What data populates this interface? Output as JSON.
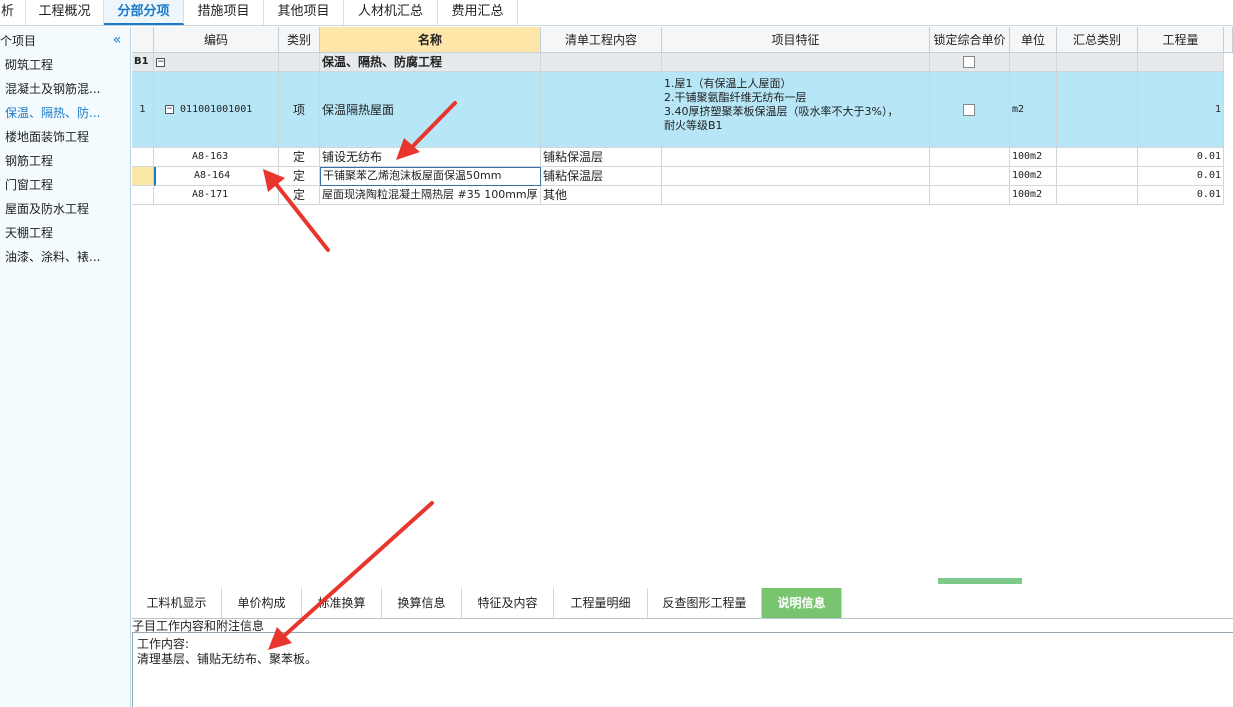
{
  "top_tabs": [
    {
      "label": "析"
    },
    {
      "label": "工程概况"
    },
    {
      "label": "分部分项",
      "active": true
    },
    {
      "label": "措施项目"
    },
    {
      "label": "其他项目"
    },
    {
      "label": "人材机汇总"
    },
    {
      "label": "费用汇总"
    }
  ],
  "sidebar": {
    "title": "个项目",
    "items": [
      {
        "label": "砌筑工程"
      },
      {
        "label": "混凝土及钢筋混..."
      },
      {
        "label": "保温、隔热、防...",
        "active": true
      },
      {
        "label": "楼地面装饰工程"
      },
      {
        "label": "钢筋工程"
      },
      {
        "label": "门窗工程"
      },
      {
        "label": "屋面及防水工程"
      },
      {
        "label": "天棚工程"
      },
      {
        "label": "油漆、涂料、裱..."
      }
    ]
  },
  "grid": {
    "headers": {
      "code": "编码",
      "type": "类别",
      "name": "名称",
      "content": "清单工程内容",
      "feature": "项目特征",
      "lock": "锁定综合单价",
      "unit": "单位",
      "summary": "汇总类别",
      "qty": "工程量"
    },
    "group": {
      "index": "B1",
      "toggle": "−",
      "name": "保温、隔热、防腐工程"
    },
    "item": {
      "index": "1",
      "toggle": "−",
      "code": "011001001001",
      "type": "项",
      "name": "保温隔热屋面",
      "feature_lines": [
        "1.屋1（有保温上人屋面）",
        "2.干铺聚氨酯纤维无纺布一层",
        "3.40厚挤塑聚苯板保温层（吸水率不大于3%），",
        "耐火等级B1"
      ],
      "unit": "m2",
      "qty": "1"
    },
    "subrows": [
      {
        "code": "A8-163",
        "type": "定",
        "name": "铺设无纺布",
        "content": "铺粘保温层",
        "unit": "100m2",
        "qty": "0.01"
      },
      {
        "code": "A8-164",
        "type": "定",
        "name": "干铺聚苯乙烯泡沫板屋面保温50mm",
        "content": "铺粘保温层",
        "unit": "100m2",
        "qty": "0.01"
      },
      {
        "code": "A8-171",
        "type": "定",
        "name": "屋面现浇陶粒混凝土隔热层 #35 100mm厚",
        "content": "其他",
        "unit": "100m2",
        "qty": "0.01"
      }
    ]
  },
  "bottom_tabs": [
    {
      "label": "工料机显示"
    },
    {
      "label": "单价构成"
    },
    {
      "label": "标准换算"
    },
    {
      "label": "换算信息"
    },
    {
      "label": "特征及内容"
    },
    {
      "label": "工程量明细"
    },
    {
      "label": "反查图形工程量"
    },
    {
      "label": "说明信息",
      "active": true
    }
  ],
  "info": {
    "section_label": "子目工作内容和附注信息",
    "line1": "工作内容:",
    "line2": "清理基层、铺贴无纺布、聚苯板。"
  },
  "colors": {
    "accent": "#1a7ac9",
    "selected_row": "#b7e6f7",
    "name_header": "#fde6a7",
    "active_bottom_tab": "#79c46e",
    "arrow": "#e8352e"
  }
}
